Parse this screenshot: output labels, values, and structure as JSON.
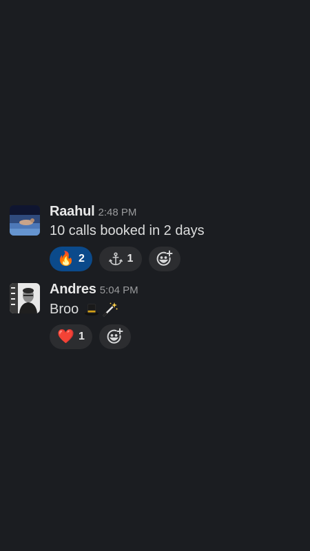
{
  "messages": [
    {
      "author": "Raahul",
      "time": "2:48 PM",
      "text": "10 calls booked in 2 days",
      "reactions": [
        {
          "emoji": "🔥",
          "count": "2",
          "active": true
        },
        {
          "icon": "anchor-icon",
          "count": "1",
          "active": false
        }
      ]
    },
    {
      "author": "Andres",
      "time": "5:04 PM",
      "text": "Broo",
      "inline_icons": [
        "top-hat-icon",
        "magic-wand-icon"
      ],
      "reactions": [
        {
          "emoji": "❤️",
          "count": "1",
          "active": false
        }
      ]
    }
  ],
  "colors": {
    "background": "#1b1d21",
    "pill": "#2c2d30",
    "pill_active": "#0b4a8b"
  }
}
